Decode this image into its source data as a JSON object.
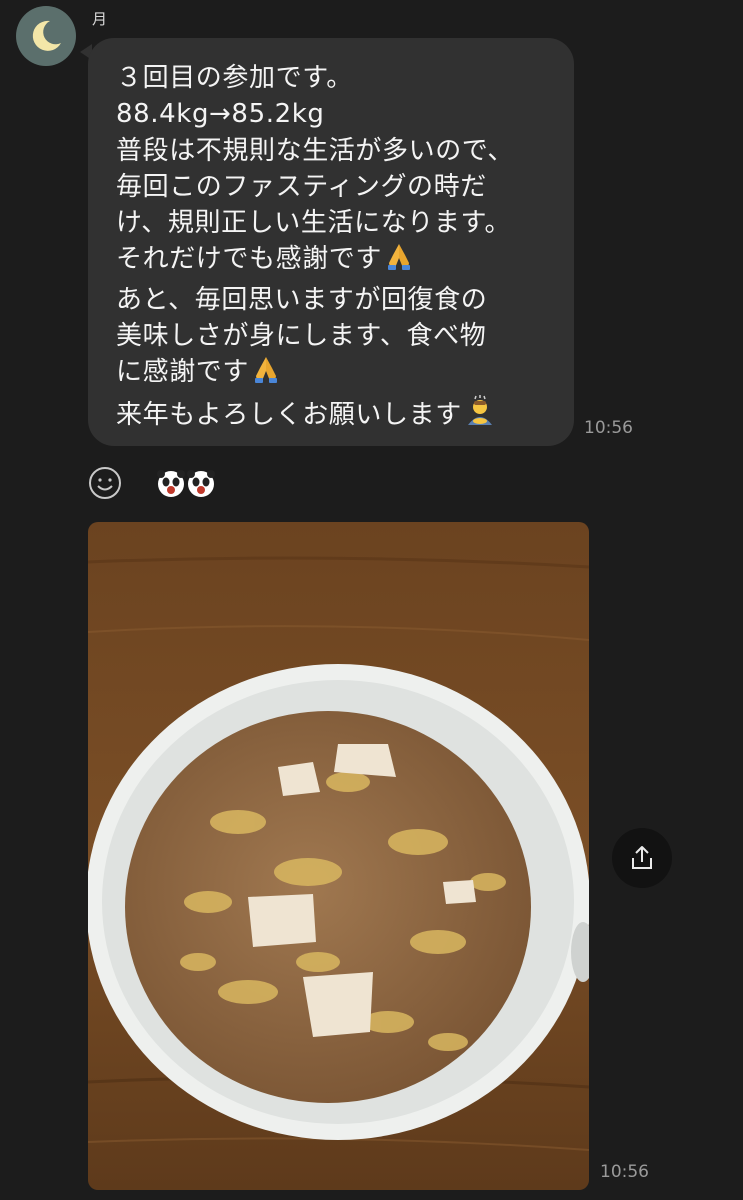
{
  "chat": {
    "sender_name": "月",
    "avatar_icon": "crescent-moon-icon",
    "message": {
      "lines": [
        "３回目の参加です。",
        "88.4kg→85.2kg",
        "普段は不規則な生活が多いので、",
        "毎回このファスティングの時だ",
        "け、規則正しい生活になります。",
        "それだけでも感謝です",
        "あと、毎回思いますが回復食の",
        "美味しさが身にします、食べ物",
        "に感謝です",
        "来年もよろしくお願いします"
      ],
      "time": "10:56"
    },
    "reactions": [
      "panda-face-icon",
      "panda-face-icon"
    ],
    "photo": {
      "description_icon": "soup-bowl-photo",
      "time": "10:56"
    }
  },
  "colors": {
    "background": "#1c1c1c",
    "bubble": "#313131",
    "text": "#f4f4f4",
    "timestamp": "#9a9a9a"
  }
}
